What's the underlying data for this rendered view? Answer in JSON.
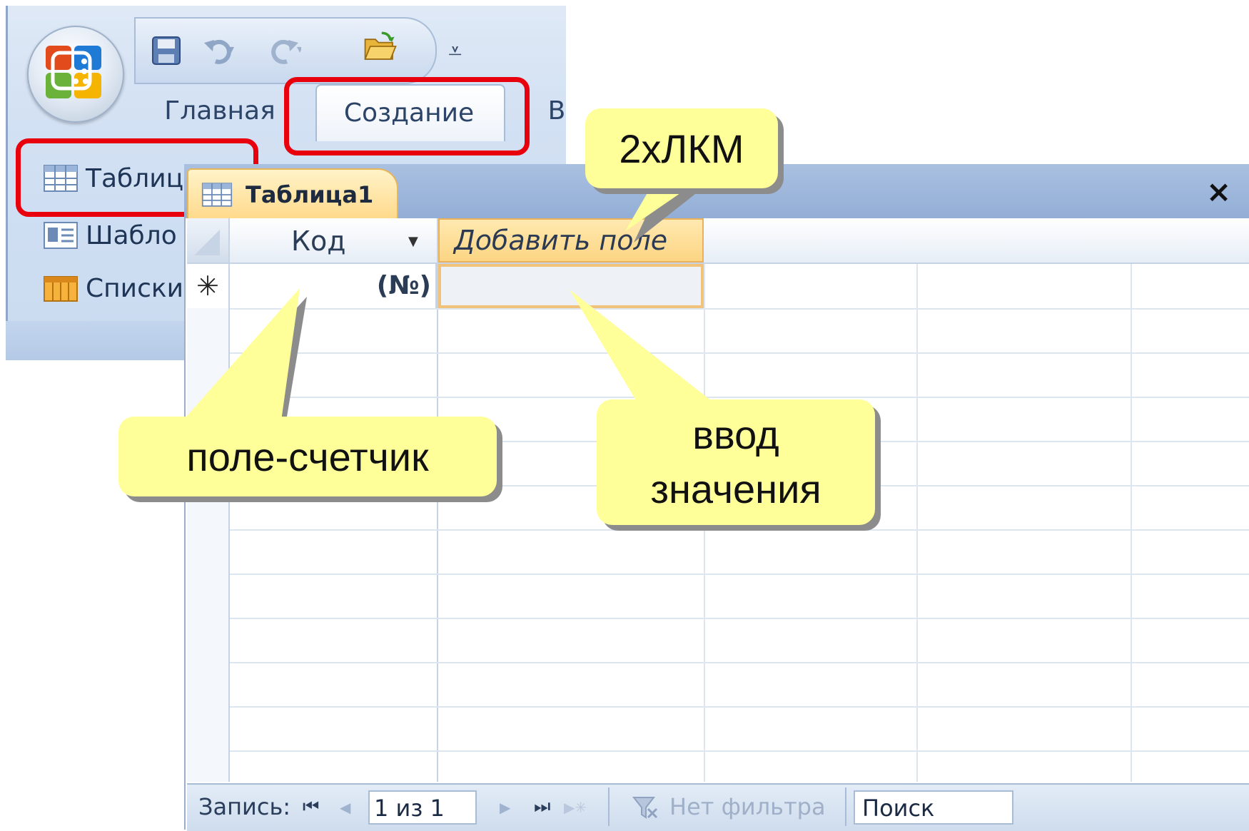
{
  "ribbon": {
    "tabs": [
      {
        "label": "Главная"
      },
      {
        "label": "Создание"
      },
      {
        "label": "В"
      }
    ],
    "items": [
      {
        "label": "Таблиц",
        "icon": "table-icon"
      },
      {
        "label": "Шабло",
        "icon": "template-icon"
      },
      {
        "label": "Списки",
        "icon": "list-icon"
      }
    ]
  },
  "window": {
    "tab_title": "Таблица1",
    "close": "×"
  },
  "datasheet": {
    "columns": [
      {
        "label": "Код",
        "has_dropdown": true
      },
      {
        "label": "Добавить поле"
      }
    ],
    "new_row": {
      "marker": "✳",
      "counter_value": "(№)",
      "add_value": ""
    }
  },
  "navbar": {
    "record_label": "Запись:",
    "first": "⏮",
    "prev": "◀",
    "record_value": "1 из 1",
    "next": "▶",
    "last": "⏭",
    "new": "▶✳",
    "filter_label": "Нет фильтра",
    "search_placeholder": "Поиск"
  },
  "callouts": {
    "double_click": "2хЛКМ",
    "counter_field": "поле-счетчик",
    "value_input_line1": "ввод",
    "value_input_line2": "значения"
  },
  "colors": {
    "highlight_red": "#e8000d",
    "callout_yellow": "#ffff99",
    "active_tab_orange": "#fcd583",
    "ribbon_blue": "#c9daf0"
  }
}
